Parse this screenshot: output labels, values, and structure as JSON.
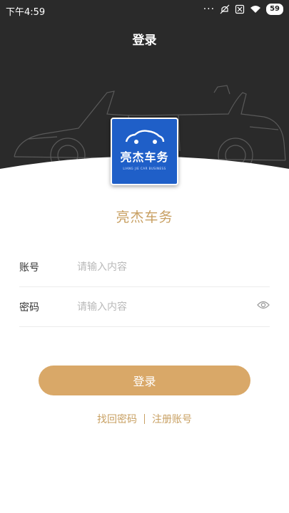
{
  "status_bar": {
    "time": "下午4:59",
    "battery": "59",
    "icons": [
      "more-dots-icon",
      "mute-icon",
      "sim-off-icon",
      "wifi-icon",
      "battery-icon"
    ]
  },
  "header": {
    "title": "登录"
  },
  "logo": {
    "name": "亮杰车务",
    "subtitle": "LIANG JIE CAR BUSINESS"
  },
  "app_name": "亮杰车务",
  "form": {
    "account": {
      "label": "账号",
      "placeholder": "请输入内容",
      "value": ""
    },
    "password": {
      "label": "密码",
      "placeholder": "请输入内容",
      "value": ""
    }
  },
  "login_button": "登录",
  "links": {
    "forgot_password": "找回密码",
    "register": "注册账号"
  },
  "colors": {
    "hero_bg": "#2a2a2a",
    "accent": "#d9a868",
    "accent_text": "#c8a063",
    "logo_bg": "#1f5fc8"
  }
}
